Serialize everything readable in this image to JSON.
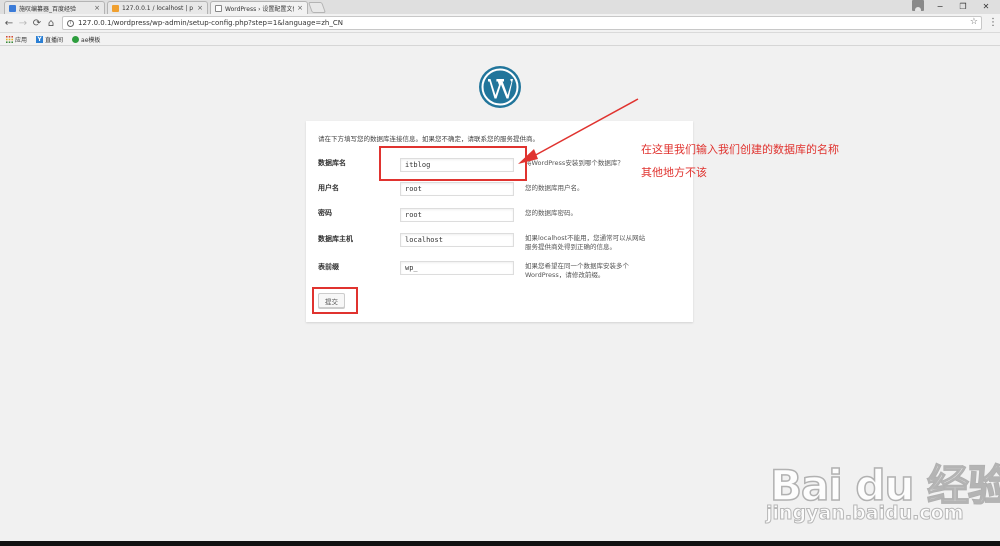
{
  "browser": {
    "tabs": [
      {
        "title": "施叹编纂器_百度经验",
        "close": "×"
      },
      {
        "title": "127.0.0.1 / localhost | p",
        "close": "×"
      },
      {
        "title": "WordPress › 设置配置文件",
        "close": "×"
      }
    ],
    "window_controls": {
      "minimize": "−",
      "maximize": "❐",
      "close": "✕"
    },
    "nav": {
      "back": "←",
      "forward": "→",
      "reload": "⟳",
      "home": "⌂"
    },
    "url": "127.0.0.1/wordpress/wp-admin/setup-config.php?step=1&language=zh_CN",
    "menu_icon": "⋮",
    "star_icon": "☆",
    "bookmarks": [
      {
        "label": "应用",
        "icon": "apps-grid-icon"
      },
      {
        "label": "直播间",
        "icon": "bookmark-y-icon"
      },
      {
        "label": "ae模板",
        "icon": "bookmark-green-icon"
      }
    ]
  },
  "page": {
    "intro": "请在下方填写您的数据库连接信息。如果您不确定，请联系您的服务提供商。",
    "fields": [
      {
        "label": "数据库名",
        "value": "itblog",
        "desc": "将WordPress安装到哪个数据库？"
      },
      {
        "label": "用户名",
        "value": "root",
        "desc": "您的数据库用户名。"
      },
      {
        "label": "密码",
        "value": "root",
        "desc": "您的数据库密码。"
      },
      {
        "label": "数据库主机",
        "value": "localhost",
        "desc": "如果localhost不能用，您通常可以从网站服务提供商处得到正确的信息。"
      },
      {
        "label": "表前缀",
        "value": "wp_",
        "desc": "如果您希望在同一个数据库安装多个WordPress，请修改前缀。"
      }
    ],
    "submit_label": "提交"
  },
  "annotation": {
    "line1": "在这里我们输入我们创建的数据库的名称",
    "line2": "其他地方不该",
    "color": "#e0332f"
  },
  "watermark": {
    "brand": "Bai du 经验",
    "url": "jingyan.baidu.com"
  },
  "colors": {
    "wp_blue": "#21759b",
    "highlight_red": "#e0332f"
  }
}
